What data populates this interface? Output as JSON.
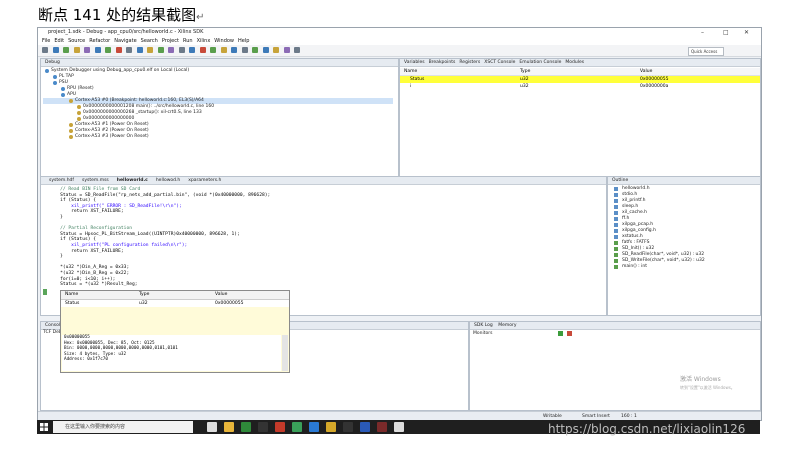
{
  "caption": {
    "text": "断点 141 处的结果截图",
    "mark": "↵"
  },
  "window": {
    "title": "project_1.sdk - Debug - app_cpu0/src/helloworld.c - Xilinx SDK",
    "controls": [
      "–",
      "□",
      "✕"
    ]
  },
  "menu": [
    "File",
    "Edit",
    "Source",
    "Refactor",
    "Navigate",
    "Search",
    "Project",
    "Run",
    "Xilinx",
    "Window",
    "Help"
  ],
  "toolbar": {
    "quick_access": "Quick Access"
  },
  "debug": {
    "tab": "Debug",
    "tree": [
      {
        "text": "System Debugger using Debug_app_cpu0.elf on Local (Local)",
        "indent": 0
      },
      {
        "text": "PL TAP",
        "indent": 1
      },
      {
        "text": "PSU",
        "indent": 1
      },
      {
        "text": "RPU (Reset)",
        "indent": 2
      },
      {
        "text": "APU",
        "indent": 2
      },
      {
        "text": "Cortex-A53 #0 (Breakpoint: helloworld.c:160, EL3(S)/A64",
        "indent": 3,
        "selected": true
      },
      {
        "text": "0x0000000000001208 main(): ../src/helloworld.c, line 160",
        "indent": 4
      },
      {
        "text": "0x0000000000000268 _startup(): xil-crt0.S, line 133",
        "indent": 4
      },
      {
        "text": "0x0000000000000000",
        "indent": 4
      },
      {
        "text": "Cortex-A53 #1 (Power On Reset)",
        "indent": 3
      },
      {
        "text": "Cortex-A53 #2 (Power On Reset)",
        "indent": 3
      },
      {
        "text": "Cortex-A53 #3 (Power On Reset)",
        "indent": 3
      }
    ]
  },
  "variables": {
    "tabs": [
      "Variables",
      "Breakpoints",
      "Registers",
      "XSCT Console",
      "Emulation Console",
      "Modules"
    ],
    "columns": [
      "Name",
      "Type",
      "Value"
    ],
    "rows": [
      {
        "name": "Status",
        "type": "u32",
        "value": "0x00000055",
        "highlight": true
      },
      {
        "name": "i",
        "type": "u32",
        "value": "0x0000000a",
        "highlight": false
      }
    ]
  },
  "editor": {
    "tabs": [
      "system.hdf",
      "system.mss",
      "helloworld.c",
      "hellowod.h",
      "xparameters.h"
    ],
    "lines": [
      {
        "t": "    // Read BIN File from SD Card",
        "c": "com"
      },
      {
        "t": "    Status = SD_ReadFile(\"rp_nets_add_partial.bin\", (void *)0x40000000, 896628);",
        "c": ""
      },
      {
        "t": "    if (Status) {",
        "c": ""
      },
      {
        "t": "        xil_printf(\" ERROR : SD_ReadFile!\\r\\n\");",
        "c": "str"
      },
      {
        "t": "        return XST_FAILURE;",
        "c": ""
      },
      {
        "t": "    }",
        "c": ""
      },
      {
        "t": "",
        "c": ""
      },
      {
        "t": "    // Partial Reconfiguration",
        "c": "com"
      },
      {
        "t": "    Status = Hpsoc_PL_BitStream_Load((UINTPTR)0x40000000, 896628, 1);",
        "c": ""
      },
      {
        "t": "    if (Status) {",
        "c": ""
      },
      {
        "t": "        xil_printf(\"PL configuration failed\\n\\r\");",
        "c": "str"
      },
      {
        "t": "        return XST_FAILURE;",
        "c": ""
      },
      {
        "t": "    }",
        "c": ""
      },
      {
        "t": "",
        "c": ""
      },
      {
        "t": "    *(u32 *)Din_A_Reg = 0x33;",
        "c": ""
      },
      {
        "t": "    *(u32 *)Din_B_Reg = 0x22;",
        "c": ""
      },
      {
        "t": "    for(i=0; i<10; i++);",
        "c": ""
      },
      {
        "t": "    Status = *(u32 *)Result_Reg;",
        "c": ""
      }
    ]
  },
  "hover": {
    "columns": [
      "Name",
      "Type",
      "Value"
    ],
    "row": {
      "name": "Status",
      "type": "u32",
      "value": "0x00000055"
    },
    "details": [
      "0x00000055",
      "Hex: 0x00000055, Dec: 85, Oct: 0125",
      "Bin: 0000,0000,0000,0000,0000,0000,0101,0101",
      "Size: 4 bytes, Type: u32",
      "Address: 0x1f7c70"
    ]
  },
  "outline": {
    "tab": "Outline",
    "items": [
      "helloworld.h",
      "stdio.h",
      "xil_printf.h",
      "sleep.h",
      "xil_cache.h",
      "ff.h",
      "xilpga_pcap.h",
      "xilpga_config.h",
      "xstatus.h",
      "fatfs : FATFS",
      "SD_Init() : u32",
      "SD_ReadFile(char*, void*, u32) : u32",
      "SD_WriteFile(char*, void*, u32) : u32",
      "main() : int"
    ]
  },
  "console": {
    "tab": "Console",
    "sub": "TCF Debug"
  },
  "sdklog": {
    "tabs": [
      "SDK Log",
      "Memory"
    ],
    "monitors": "Monitors"
  },
  "status": {
    "writable": "Writable",
    "insert": "Smart Insert",
    "pos": "160 : 1"
  },
  "activation": {
    "line1": "激活 Windows",
    "line2": "转到\"设置\"以激活 Windows。"
  },
  "taskbar": {
    "search": "在这里输入你要搜索的内容"
  },
  "watermark": "https://blog.csdn.net/lixiaolin126"
}
